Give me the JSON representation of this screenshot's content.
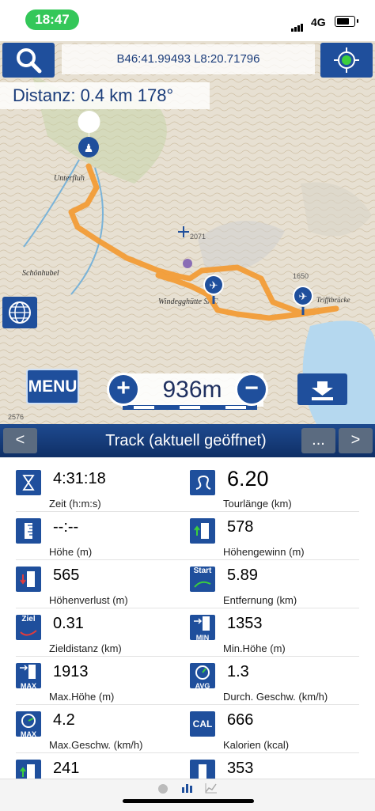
{
  "status": {
    "time": "18:47",
    "network": "4G"
  },
  "map": {
    "coordinates": "B46:41.99493 L8:20.71796",
    "distance": "Distanz: 0.4 km 178°",
    "menu_label": "MENU",
    "zoom_value": "936m",
    "place_labels": [
      "Windegghütte SAC",
      "Schönhubel",
      "Unterfluh",
      "Trifftbrücke",
      "1650",
      "2071",
      "2576"
    ]
  },
  "track": {
    "title": "Track (aktuell geöffnet)",
    "prev_label": "<",
    "more_label": "...",
    "next_label": ">"
  },
  "stats": [
    {
      "left": {
        "icon": "hourglass-icon",
        "value": "4:31:18",
        "label": "Zeit (h:m:s)"
      },
      "right": {
        "icon": "track-length-icon",
        "value": "6.20",
        "label": "Tourlänge (km)"
      }
    },
    {
      "left": {
        "icon": "altitude-icon",
        "value": "--:--",
        "label": "Höhe (m)"
      },
      "right": {
        "icon": "altitude-gain-icon",
        "value": "578",
        "label": "Höhengewinn (m)"
      }
    },
    {
      "left": {
        "icon": "altitude-loss-icon",
        "value": "565",
        "label": "Höhenverlust (m)"
      },
      "right": {
        "icon": "start-distance-icon",
        "icon_text": "Start",
        "value": "5.89",
        "label": "Entfernung (km)"
      }
    },
    {
      "left": {
        "icon": "target-distance-icon",
        "icon_text": "Ziel",
        "value": "0.31",
        "label": "Zieldistanz (km)"
      },
      "right": {
        "icon": "min-altitude-icon",
        "icon_text": "MIN",
        "value": "1353",
        "label": "Min.Höhe (m)"
      }
    },
    {
      "left": {
        "icon": "max-altitude-icon",
        "icon_text": "MAX",
        "value": "1913",
        "label": "Max.Höhe (m)"
      },
      "right": {
        "icon": "avg-speed-icon",
        "icon_text": "AVG",
        "value": "1.3",
        "label": "Durch. Geschw. (km/h)"
      }
    },
    {
      "left": {
        "icon": "max-speed-icon",
        "icon_text": "MAX",
        "value": "4.2",
        "label": "Max.Geschw. (km/h)"
      },
      "right": {
        "icon": "calories-icon",
        "icon_text": "CAL",
        "value": "666",
        "label": "Kalorien (kcal)"
      }
    },
    {
      "left": {
        "icon": "altitude-gain-icon",
        "value": "241",
        "label": ""
      },
      "right": {
        "icon": "altitude-icon",
        "value": "353",
        "label": ""
      }
    }
  ]
}
